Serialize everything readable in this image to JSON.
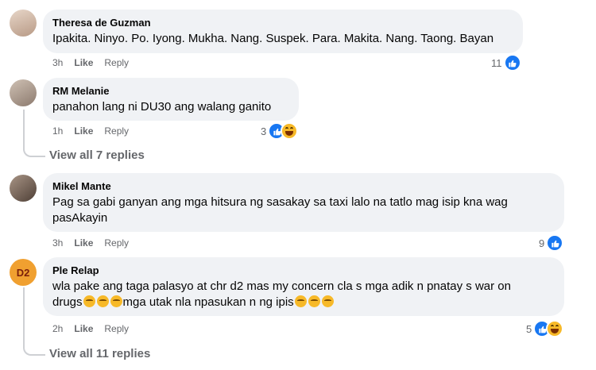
{
  "comments": [
    {
      "author": "Theresa de Guzman",
      "text": "Ipakita. Ninyo. Po. Iyong. Mukha. Nang. Suspek. Para. Makita. Nang. Taong. Bayan",
      "time": "3h",
      "like_label": "Like",
      "reply_label": "Reply",
      "reaction_count": "11",
      "reactions": [
        "like"
      ]
    },
    {
      "author": "RM Melanie",
      "text": "panahon lang ni DU30 ang walang ganito",
      "time": "1h",
      "like_label": "Like",
      "reply_label": "Reply",
      "reaction_count": "3",
      "reactions": [
        "like",
        "haha"
      ],
      "view_replies": "View all 7 replies"
    },
    {
      "author": "Mikel Mante",
      "text_line1": "Pag sa gabi ganyan ang mga hitsura ng sasakay sa taxi lalo na tatlo mag isip kna wag",
      "text_line2": "pasAkayin",
      "time": "3h",
      "like_label": "Like",
      "reply_label": "Reply",
      "reaction_count": "9",
      "reactions": [
        "like"
      ]
    },
    {
      "author": "Ple Relap",
      "text_line1": "wla pake ang taga palasyo at chr d2 mas my concern cla s mga adik n pnatay s war on",
      "text_line2a": "drugs",
      "text_line2b": "mga utak nla npasukan n ng ipis",
      "time": "2h",
      "like_label": "Like",
      "reply_label": "Reply",
      "reaction_count": "5",
      "reactions": [
        "like",
        "haha"
      ],
      "view_replies": "View all 11 replies",
      "avatar_text": "D2"
    }
  ],
  "colors": {
    "like": "#1877f2",
    "haha": "#f7b928",
    "bubble": "#f0f2f5",
    "meta": "#65676b"
  }
}
